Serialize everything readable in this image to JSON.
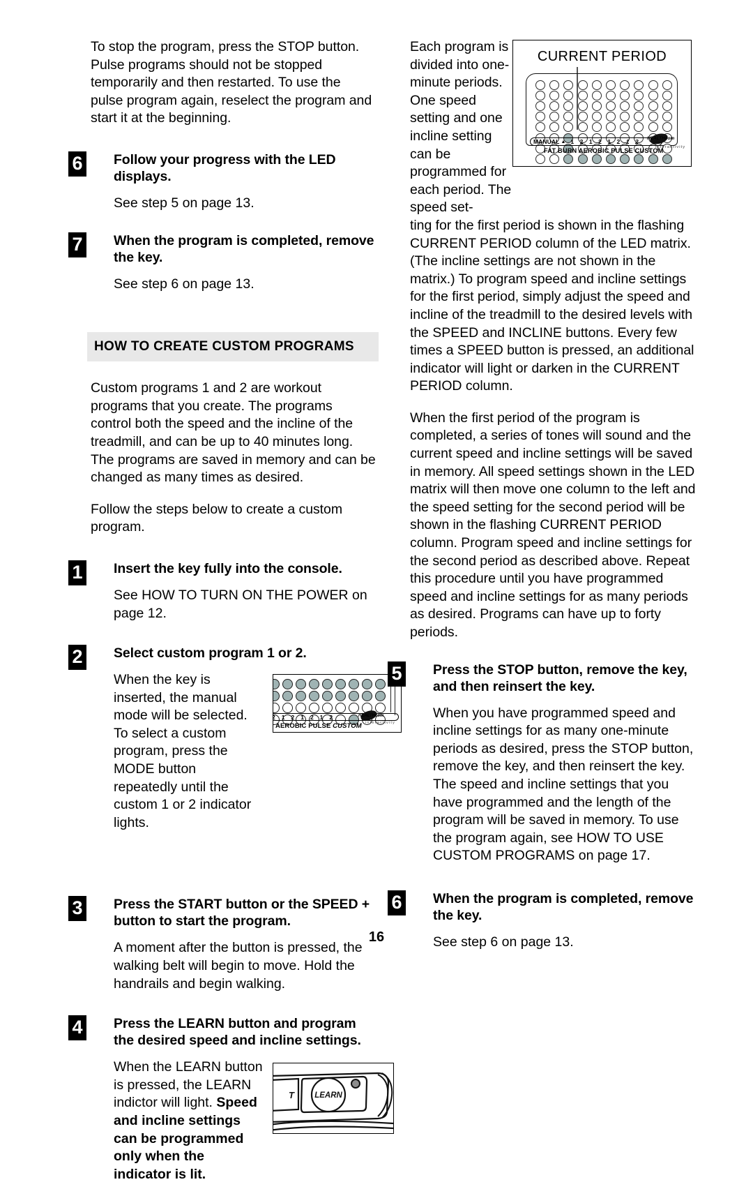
{
  "page": {
    "number": "16"
  },
  "left_column": {
    "intro_paragraph": "To stop the program, press the STOP button. Pulse programs should not be stopped temporarily and then restarted. To use the pulse program again, reselect the program and start it at the beginning.",
    "steps_top": [
      {
        "number": "6",
        "title": "Follow your progress with the LED displays.",
        "body": "See step 5 on page 13."
      },
      {
        "number": "7",
        "title": "When the program is completed, remove the key.",
        "body": "See step 6 on page 13."
      }
    ],
    "section_heading": "HOW TO CREATE CUSTOM PROGRAMS",
    "section_paragraph_1": "Custom programs 1 and 2 are workout programs that you create. The programs control both the speed and the incline of the treadmill, and can be up to 40 minutes long. The programs are saved in memory and can be changed as many times as desired.",
    "section_paragraph_2": "Follow the steps below to create a custom program.",
    "steps": [
      {
        "number": "1",
        "title": "Insert the key fully into the console.",
        "body": "See HOW TO TURN ON THE POWER on page 12."
      },
      {
        "number": "2",
        "title": "Select custom program 1 or 2.",
        "body": "When the key is inserted, the manual mode will be selected. To select a custom program, press the MODE button repeatedly until the custom 1 or 2 indicator lights."
      },
      {
        "number": "3",
        "title": "Press the START button or the SPEED + button to start the program.",
        "body": "A moment after the button is pressed, the walking belt will begin to move. Hold the handrails and begin walking."
      },
      {
        "number": "4",
        "title": "Press the LEARN button and program the desired speed and incline settings.",
        "body_normal": "When the LEARN button is pressed, the LEARN indictor will light. ",
        "body_bold": "Speed and incline settings can be programmed only when the indicator is lit."
      }
    ]
  },
  "right_column": {
    "paragraph_1_narrow": "Each program is divided into one-minute periods. One speed setting and one incline setting can be programmed for each period. The speed set-",
    "paragraph_1_rest": "ting for the first period is shown in the flashing CURRENT PERIOD column of the LED matrix. (The incline settings are not shown in the matrix.) To program speed and incline settings for the first period, simply adjust the speed and incline of the treadmill to the desired levels with the SPEED and INCLINE buttons. Every few times a SPEED button is pressed, an additional indicator will light or darken in the CURRENT PERIOD column.",
    "paragraph_2": "When the first period of the program is completed, a series of tones will sound and the current speed and incline settings will be saved in memory. All speed settings shown in the LED matrix will then move one column to the left and the speed setting for the second period will be shown in the flashing CURRENT PERIOD column. Program speed and incline settings for the second period as described above. Repeat this procedure until you have programmed speed and incline settings for as many periods as desired. Programs can have up to forty periods.",
    "steps": [
      {
        "number": "5",
        "title": "Press the STOP button, remove the key, and then reinsert the key.",
        "body": "When you have programmed speed and incline settings for as many one-minute periods as desired, press the STOP button, remove the key, and then reinsert the key. The speed and incline settings that you have programmed and the length of the program will be saved in memory. To use the program again, see HOW TO USE CUSTOM PROGRAMS on page 17."
      },
      {
        "number": "6",
        "title": "When the program is completed, remove the key.",
        "body": "See step 6 on page 13."
      }
    ]
  },
  "figures": {
    "current_period": {
      "title": "CURRENT PERIOD",
      "manual_label": "MANUAL",
      "triangle": "▲",
      "column_numbers": [
        "1",
        "2",
        "1",
        "2",
        "1",
        "2",
        "1",
        "2"
      ],
      "mode_labels": "FAT BURN AEROBIC PULSE CUSTOM",
      "brand": "HEALTHcom",
      "brand_sub": "interactivity",
      "matrix_rows": 8,
      "matrix_cols": 10,
      "lit_cells": [
        [
          5,
          2
        ],
        [
          6,
          2
        ],
        [
          7,
          2
        ],
        [
          7,
          3
        ],
        [
          7,
          4
        ],
        [
          7,
          5
        ],
        [
          7,
          6
        ],
        [
          7,
          7
        ],
        [
          7,
          8
        ],
        [
          7,
          9
        ]
      ]
    },
    "console_led": {
      "column_numbers": [
        "2",
        "1",
        "2",
        "1",
        "2",
        "1",
        "2"
      ],
      "caption_plain": "AEROBIC PULSE ",
      "caption_italic": "CUSTOM",
      "brand": "HEALTHcom",
      "brand_sub": "interactivity",
      "matrix_rows": 4,
      "matrix_cols": 9,
      "lit_cells": [
        [
          0,
          0
        ],
        [
          0,
          1
        ],
        [
          0,
          2
        ],
        [
          0,
          3
        ],
        [
          0,
          4
        ],
        [
          0,
          5
        ],
        [
          0,
          6
        ],
        [
          0,
          7
        ],
        [
          0,
          8
        ],
        [
          1,
          0
        ],
        [
          1,
          1
        ],
        [
          1,
          2
        ],
        [
          1,
          3
        ],
        [
          1,
          4
        ],
        [
          1,
          5
        ],
        [
          1,
          6
        ],
        [
          1,
          7
        ],
        [
          1,
          8
        ],
        [
          3,
          6
        ]
      ]
    },
    "learn_console": {
      "button_label": "LEARN",
      "partial_label": "T"
    }
  }
}
